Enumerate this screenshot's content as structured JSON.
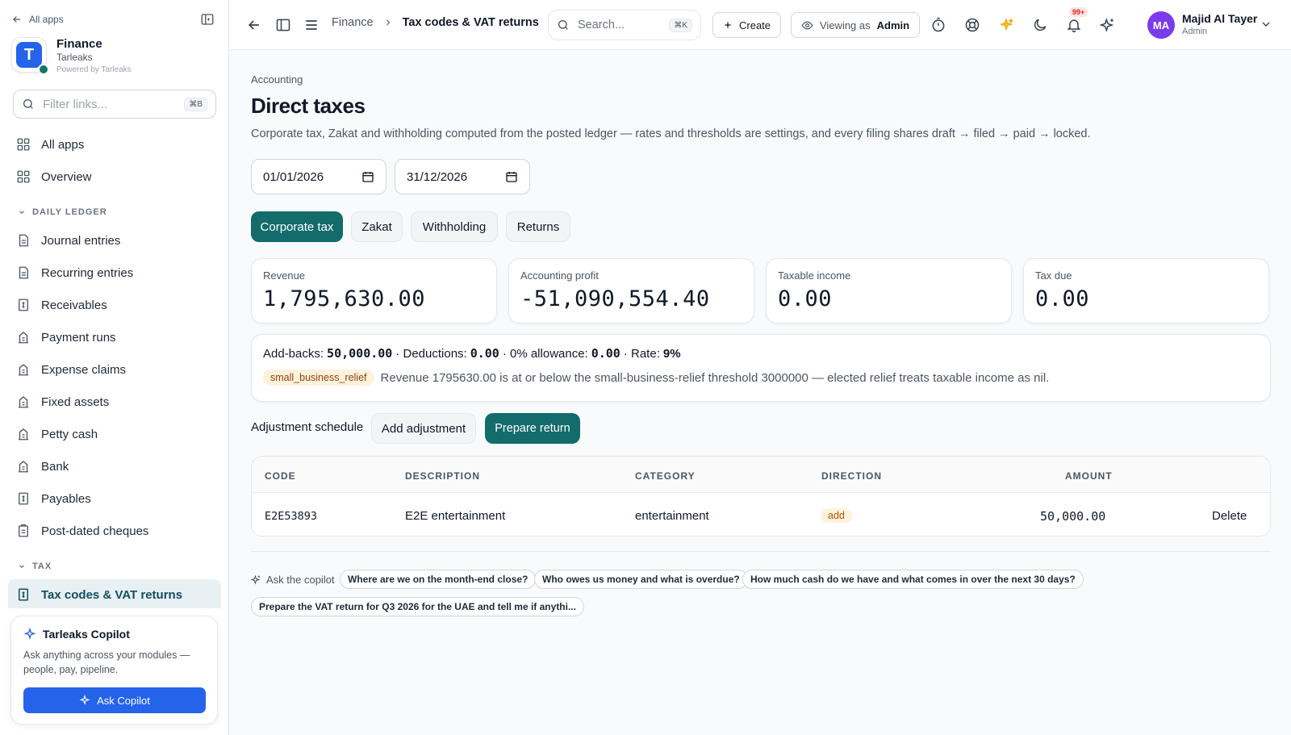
{
  "sidebar": {
    "back_label": "All apps",
    "app_name": "Finance",
    "app_org": "Tarleaks",
    "app_powered": "Powered by Tarleaks",
    "logo_letter": "T",
    "filter_placeholder": "Filter links...",
    "filter_shortcut": "⌘B",
    "top_items": [
      "All apps",
      "Overview"
    ],
    "section_daily": "DAILY LEDGER",
    "daily_items": [
      "Journal entries",
      "Recurring entries",
      "Receivables",
      "Payment runs",
      "Expense claims",
      "Fixed assets",
      "Petty cash",
      "Bank",
      "Payables",
      "Post-dated cheques"
    ],
    "section_tax": "TAX",
    "tax_items": [
      "Tax codes & VAT returns"
    ],
    "copilot": {
      "title": "Tarleaks Copilot",
      "description": "Ask anything across your modules — people, pay, pipeline.",
      "button": "Ask Copilot"
    }
  },
  "topbar": {
    "crumb_parent": "Finance",
    "crumb_current": "Tax codes & VAT returns",
    "search_placeholder": "Search...",
    "search_shortcut": "⌘K",
    "create_label": "Create",
    "viewing_prefix": "Viewing as",
    "viewing_role": "Admin",
    "notification_count": "99+",
    "user_initials": "MA",
    "user_name": "Majid Al Tayer",
    "user_role": "Admin"
  },
  "main": {
    "eyebrow": "Accounting",
    "title": "Direct taxes",
    "subtitle": "Corporate tax, Zakat and withholding computed from the posted ledger — rates and thresholds are settings, and every filing shares draft → filed → paid → locked.",
    "date_from": "01/01/2026",
    "date_to": "31/12/2026",
    "tabs": [
      "Corporate tax",
      "Zakat",
      "Withholding",
      "Returns"
    ],
    "kpis": [
      {
        "label": "Revenue",
        "value": "1,795,630.00"
      },
      {
        "label": "Accounting profit",
        "value": "-51,090,554.40"
      },
      {
        "label": "Taxable income",
        "value": "0.00"
      },
      {
        "label": "Tax due",
        "value": "0.00"
      }
    ],
    "summary": {
      "addbacks_label": "Add-backs:",
      "addbacks_value": "50,000.00",
      "deductions_label": "· Deductions:",
      "deductions_value": "0.00",
      "allowance_label": "· 0% allowance:",
      "allowance_value": "0.00",
      "rate_label": "· Rate:",
      "rate_value": "9%",
      "relief_tag": "small_business_relief",
      "relief_text": "Revenue 1795630.00 is at or below the small-business-relief threshold 3000000 — elected relief treats taxable income as nil."
    },
    "schedule_label": "Adjustment schedule",
    "add_adjustment": "Add adjustment",
    "prepare_return": "Prepare return",
    "table": {
      "headers": [
        "CODE",
        "DESCRIPTION",
        "CATEGORY",
        "DIRECTION",
        "AMOUNT"
      ],
      "rows": [
        {
          "code": "E2E53893",
          "description": "E2E entertainment",
          "category": "entertainment",
          "direction": "add",
          "amount": "50,000.00",
          "action": "Delete"
        }
      ]
    },
    "ask": {
      "label": "Ask the copilot",
      "chips": [
        "Where are we on the month-end close?",
        "Who owes us money and what is overdue?",
        "How much cash do we have and what comes in over the next 30 days?",
        "Prepare the VAT return for Q3 2026 for the UAE and tell me if anythi..."
      ]
    }
  },
  "colors": {
    "accent": "#146b6b",
    "brand": "#2563eb",
    "avatar": "#7c3aed"
  }
}
